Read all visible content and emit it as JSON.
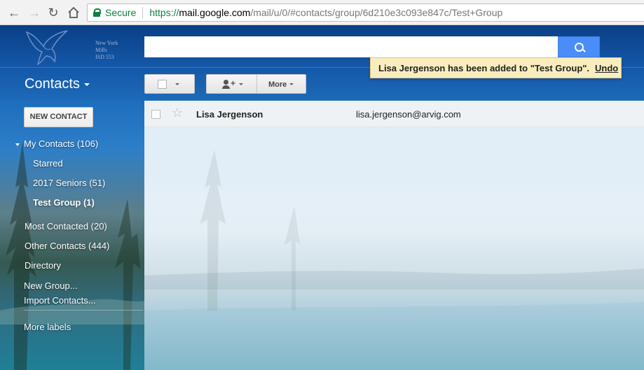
{
  "browser": {
    "secure_label": "Secure",
    "url_https": "https://",
    "url_host": "mail.google.com",
    "url_path": "/mail/u/0/#contacts/group/6d210e3c093e847c/Test+Group",
    "icons": {
      "back": "arrow-left",
      "forward": "arrow-right",
      "reload": "reload",
      "home": "home",
      "secure": "lock"
    }
  },
  "header": {
    "logo_text_line1": "New York Mills",
    "logo_text_line2": "ISD 553",
    "search_value": "",
    "app_title": "Contacts",
    "toolbar": {
      "more_label": "More"
    }
  },
  "toast": {
    "message": "Lisa Jergenson has been added to \"Test Group\".",
    "undo_label": "Undo"
  },
  "sidebar": {
    "new_contact_label": "NEW CONTACT",
    "my_contacts": "My Contacts (106)",
    "starred": "Starred",
    "seniors": "2017 Seniors (51)",
    "test_group": "Test Group (1)",
    "most_contacted": "Most Contacted (20)",
    "other_contacts": "Other Contacts (444)",
    "directory": "Directory",
    "new_group": "New Group...",
    "import_contacts": "Import Contacts...",
    "more_labels": "More labels"
  },
  "contacts": [
    {
      "name": "Lisa Jergenson",
      "email": "lisa.jergenson@arvig.com"
    }
  ],
  "colors": {
    "search_button": "#4a8df8",
    "toast_background": "#f9edbe",
    "secure_green": "#0b8043"
  }
}
